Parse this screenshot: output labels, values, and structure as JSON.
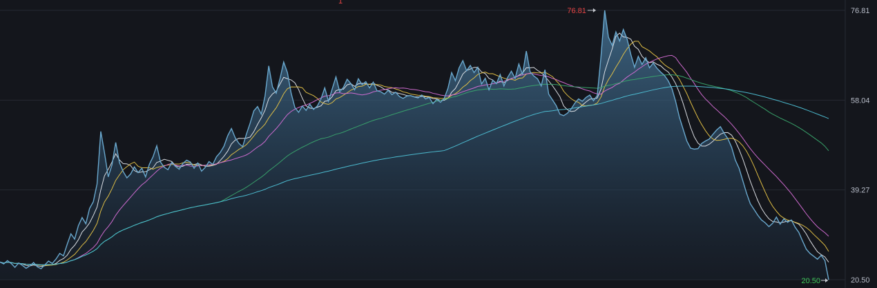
{
  "colors": {
    "background": "#14161c",
    "grid": "#262a33",
    "price_line": "#6aa9cf",
    "area_top": "#4b7ea3",
    "max_label": "#e84545",
    "min_label": "#3ec85a",
    "axis_text": "#b7bcc8"
  },
  "chart_data": {
    "type": "area",
    "y_axis": {
      "position": "right",
      "ticks": [
        "76.81",
        "58.04",
        "39.27",
        "20.50"
      ],
      "range": [
        20.5,
        76.81
      ]
    },
    "grid": true,
    "legend": "none",
    "max_marker": {
      "label": "76.81",
      "value": 76.81,
      "index": 160
    },
    "min_marker": {
      "label": "20.50",
      "value": 20.5,
      "index": 228
    },
    "price": [
      24.2,
      23.8,
      24.5,
      23.9,
      23.1,
      24.0,
      23.5,
      22.9,
      23.4,
      24.1,
      23.2,
      22.8,
      23.6,
      24.4,
      23.9,
      24.8,
      26.0,
      25.5,
      27.9,
      30.1,
      29.0,
      31.8,
      33.5,
      32.2,
      35.4,
      36.8,
      40.5,
      51.5,
      47.0,
      42.0,
      44.5,
      49.2,
      45.0,
      43.1,
      41.8,
      42.6,
      44.1,
      42.9,
      43.8,
      42.0,
      44.6,
      46.2,
      48.5,
      45.1,
      44.0,
      43.5,
      45.0,
      44.2,
      43.6,
      44.8,
      45.5,
      45.1,
      43.8,
      44.9,
      43.2,
      44.0,
      45.2,
      44.6,
      46.2,
      47.1,
      48.4,
      50.6,
      52.1,
      50.2,
      49.0,
      48.3,
      50.9,
      53.2,
      55.8,
      56.7,
      55.1,
      58.9,
      65.2,
      60.8,
      59.5,
      62.5,
      66.0,
      63.8,
      59.5,
      56.5,
      55.5,
      56.8,
      55.9,
      57.2,
      56.1,
      56.8,
      58.3,
      60.6,
      57.8,
      60.4,
      62.9,
      59.8,
      60.7,
      62.4,
      61.5,
      60.2,
      62.5,
      61.3,
      61.9,
      60.6,
      61.8,
      60.0,
      59.8,
      59.3,
      60.1,
      59.2,
      59.7,
      58.8,
      58.4,
      58.9,
      59.0,
      58.7,
      58.5,
      59.1,
      58.3,
      58.6,
      57.3,
      58.2,
      57.6,
      58.4,
      60.5,
      63.8,
      62.1,
      64.8,
      66.3,
      64.2,
      65.3,
      63.8,
      64.9,
      61.4,
      62.6,
      60.2,
      62.2,
      61.5,
      63.4,
      61.0,
      62.8,
      64.1,
      62.6,
      65.6,
      63.4,
      68.3,
      64.0,
      63.1,
      62.5,
      61.0,
      64.4,
      59.3,
      58.1,
      56.9,
      55.1,
      54.8,
      55.3,
      56.2,
      57.4,
      58.3,
      57.8,
      58.6,
      59.1,
      57.9,
      59.0,
      67.1,
      76.81,
      71.2,
      69.5,
      72.3,
      70.4,
      72.8,
      70.8,
      67.6,
      64.9,
      67.2,
      65.5,
      66.9,
      64.8,
      65.8,
      64.7,
      63.9,
      63.2,
      62.1,
      60.5,
      57.8,
      54.5,
      52.0,
      49.5,
      48.0,
      47.8,
      47.9,
      49.0,
      49.5,
      49.9,
      50.9,
      51.8,
      52.5,
      51.1,
      50.0,
      48.2,
      45.5,
      43.8,
      41.2,
      38.6,
      36.4,
      35.2,
      34.0,
      33.0,
      32.4,
      31.6,
      32.3,
      33.6,
      32.1,
      33.2,
      32.5,
      33.0,
      31.5,
      30.4,
      28.6,
      26.9,
      26.0,
      25.4,
      24.8,
      25.6,
      24.5,
      20.5
    ],
    "moving_averages": [
      {
        "color": "#e6e9ee",
        "period": 5
      },
      {
        "color": "#e8c547",
        "period": 10
      },
      {
        "color": "#d86fd8",
        "period": 20
      },
      {
        "color": "#3aa86e",
        "period": 60
      },
      {
        "color": "#4fc3d8",
        "period": 120
      }
    ]
  },
  "top_marker": {
    "label": "1"
  }
}
